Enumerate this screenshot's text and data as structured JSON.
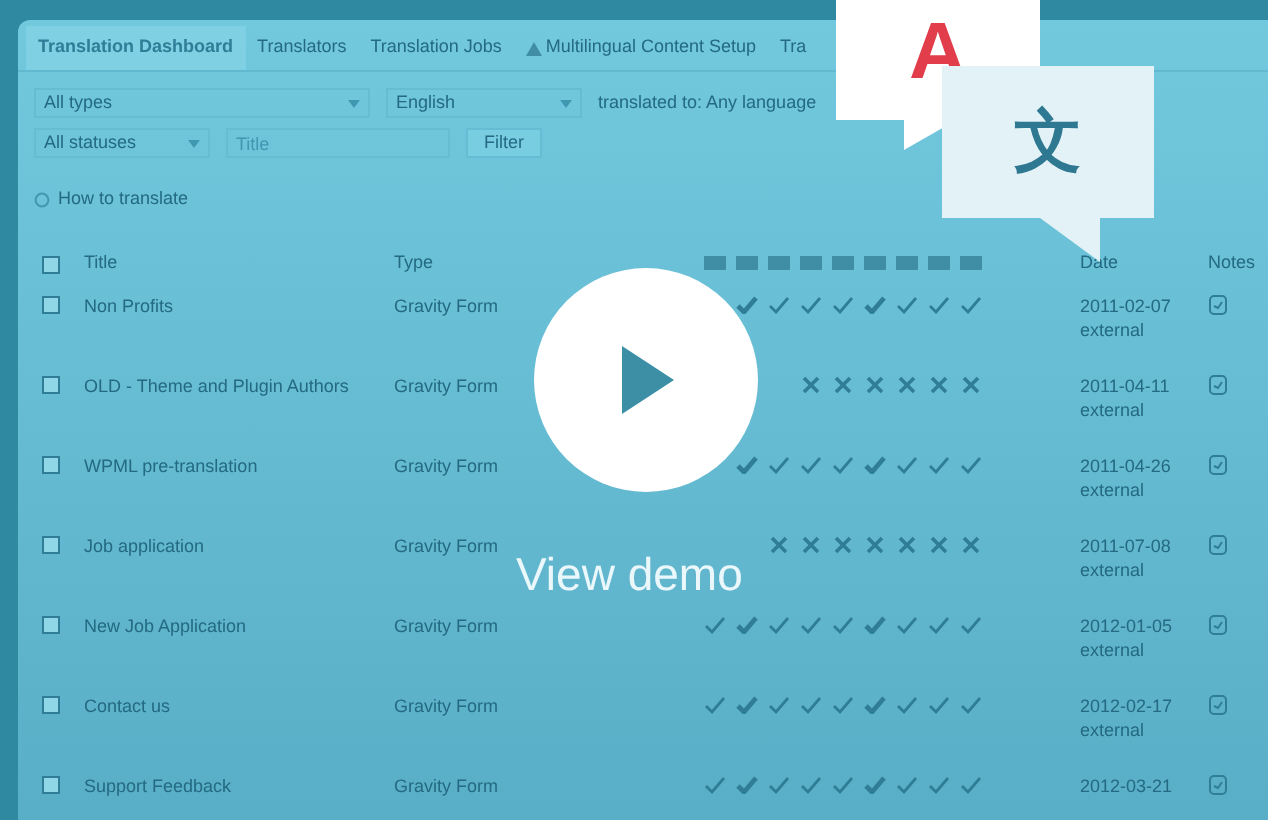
{
  "tabs": [
    {
      "label": "Translation Dashboard",
      "selected": true,
      "warning": false
    },
    {
      "label": "Translators",
      "selected": false,
      "warning": false
    },
    {
      "label": "Translation Jobs",
      "selected": false,
      "warning": false
    },
    {
      "label": "Multilingual Content Setup",
      "selected": false,
      "warning": true
    },
    {
      "label": "Tra",
      "selected": false,
      "warning": false
    }
  ],
  "filters": {
    "type": "All types",
    "source_language": "English",
    "target": "translated to: Any language",
    "status": "All statuses",
    "title_placeholder": "Title",
    "button": "Filter"
  },
  "help_link": "How to translate",
  "table": {
    "columns": [
      "Title",
      "Type",
      "Date",
      "Notes"
    ],
    "all_checked": false,
    "rows": [
      {
        "checked": false,
        "title": "Non Profits",
        "type": "Gravity Form",
        "complete": true,
        "date": "2011-02-07",
        "source": "external"
      },
      {
        "checked": false,
        "title": "OLD - Theme and Plugin Authors",
        "type": "Gravity Form",
        "complete": false,
        "date": "2011-04-11",
        "source": "external"
      },
      {
        "checked": false,
        "title": "WPML pre-translation",
        "type": "Gravity Form",
        "complete": true,
        "date": "2011-04-26",
        "source": "external"
      },
      {
        "checked": false,
        "title": "Job application",
        "type": "Gravity Form",
        "complete": false,
        "date": "2011-07-08",
        "source": "external"
      },
      {
        "checked": false,
        "title": "New Job Application",
        "type": "Gravity Form",
        "complete": true,
        "date": "2012-01-05",
        "source": "external"
      },
      {
        "checked": false,
        "title": "Contact us",
        "type": "Gravity Form",
        "complete": true,
        "date": "2012-02-17",
        "source": "external"
      },
      {
        "checked": false,
        "title": "Support Feedback",
        "type": "Gravity Form",
        "complete": true,
        "date": "2012-03-21"
      }
    ]
  },
  "overlay": {
    "caption": "View demo",
    "bubble_latin": "A",
    "bubble_cjk": "文"
  }
}
